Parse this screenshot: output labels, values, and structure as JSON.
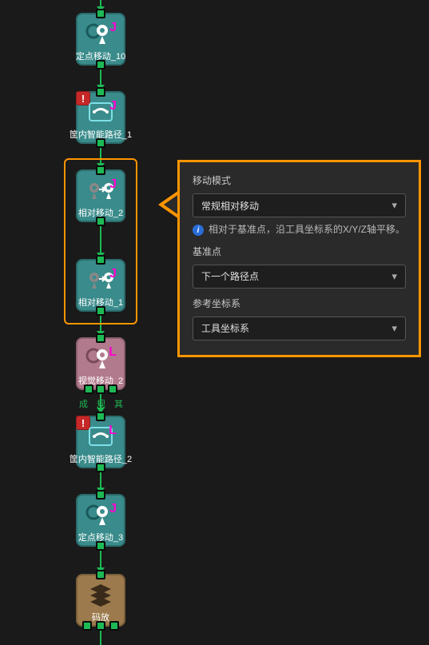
{
  "nodes": {
    "n0": {
      "label": "定点移动_10",
      "badge": "J"
    },
    "n1": {
      "label": "筐内智能路径_1",
      "badge": "J",
      "error": "!"
    },
    "n2": {
      "label": "相对移动_2",
      "badge": "J"
    },
    "n3": {
      "label": "相对移动_1",
      "badge": "J"
    },
    "n4": {
      "label": "视觉移动_2",
      "badge": "L"
    },
    "n5": {
      "label": "筐内智能路径_2",
      "badge": "L",
      "error": "!"
    },
    "n6": {
      "label": "定点移动_3",
      "badge": "J"
    },
    "n7": {
      "label": "码放"
    }
  },
  "branches": [
    "成",
    "规",
    "其"
  ],
  "panel": {
    "mode_label": "移动模式",
    "mode_value": "常规相对移动",
    "info_text": "相对于基准点，沿工具坐标系的X/Y/Z轴平移。",
    "base_label": "基准点",
    "base_value": "下一个路径点",
    "ref_label": "参考坐标系",
    "ref_value": "工具坐标系"
  }
}
